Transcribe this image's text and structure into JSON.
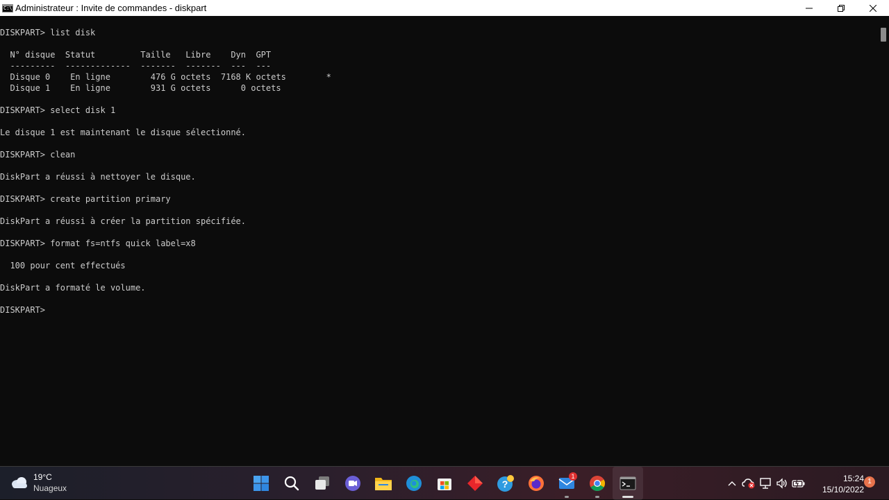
{
  "window": {
    "title": "Administrateur : Invite de commandes - diskpart",
    "icon_label": "C:\\",
    "controls": [
      "minimize-icon",
      "maximize-icon",
      "close-icon"
    ]
  },
  "console": {
    "lines": [
      "DISKPART> list disk",
      "",
      "  N° disque  Statut         Taille   Libre    Dyn  GPT",
      "  ---------  -------------  -------  -------  ---  ---",
      "  Disque 0    En ligne        476 G octets  7168 K octets        *",
      "  Disque 1    En ligne        931 G octets      0 octets",
      "",
      "DISKPART> select disk 1",
      "",
      "Le disque 1 est maintenant le disque sélectionné.",
      "",
      "DISKPART> clean",
      "",
      "DiskPart a réussi à nettoyer le disque.",
      "",
      "DISKPART> create partition primary",
      "",
      "DiskPart a réussi à créer la partition spécifiée.",
      "",
      "DISKPART> format fs=ntfs quick label=x8",
      "",
      "  100 pour cent effectués",
      "",
      "DiskPart a formaté le volume.",
      "",
      "DISKPART>"
    ]
  },
  "taskbar": {
    "weather": {
      "temp": "19°C",
      "condition": "Nuageux",
      "icon": "cloud-icon"
    },
    "apps": [
      {
        "name": "start-button",
        "icon": "windows-logo-icon"
      },
      {
        "name": "search-button",
        "icon": "search-icon"
      },
      {
        "name": "task-view-button",
        "icon": "task-view-icon"
      },
      {
        "name": "teams-chat-button",
        "icon": "chat-icon"
      },
      {
        "name": "file-explorer-button",
        "icon": "folder-icon"
      },
      {
        "name": "edge-button",
        "icon": "edge-icon"
      },
      {
        "name": "store-button",
        "icon": "store-icon"
      },
      {
        "name": "app-red-button",
        "icon": "red-diamond-icon"
      },
      {
        "name": "help-app-button",
        "icon": "help-icon"
      },
      {
        "name": "firefox-button",
        "icon": "firefox-icon"
      },
      {
        "name": "mail-button",
        "icon": "mail-icon",
        "badge": "1"
      },
      {
        "name": "chrome-button",
        "icon": "chrome-icon"
      },
      {
        "name": "terminal-button",
        "icon": "terminal-icon",
        "active": true
      }
    ],
    "tray": {
      "icons": [
        "chevron-up-icon",
        "onedrive-error-icon",
        "network-icon",
        "volume-icon",
        "battery-icon"
      ],
      "time": "15:24",
      "date": "15/10/2022",
      "notifications": "1"
    }
  },
  "colors": {
    "console_bg": "#0c0c0c",
    "console_fg": "#cccccc",
    "titlebar_bg": "#ffffff"
  }
}
